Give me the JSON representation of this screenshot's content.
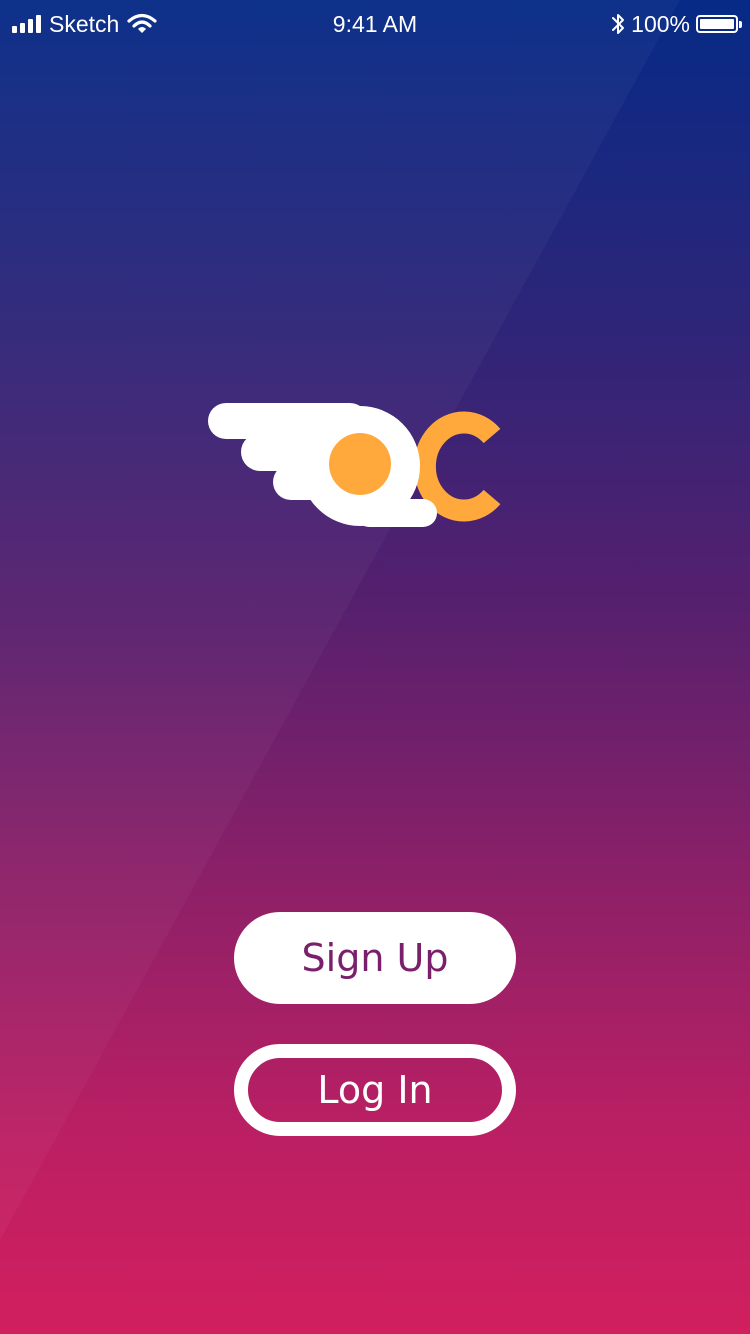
{
  "status_bar": {
    "carrier": "Sketch",
    "time": "9:41 AM",
    "battery": "100%",
    "icons": [
      "signal-bars-icon",
      "wifi-icon",
      "bluetooth-icon",
      "battery-icon"
    ]
  },
  "logo": {
    "icon": "winged-egg-logo",
    "colors": {
      "wing": "#ffffff",
      "yolk": "#ffa93d",
      "letter": "#ffa93d"
    }
  },
  "actions": {
    "signup_label": "Sign Up",
    "login_label": "Log In"
  },
  "colors": {
    "gradient_top": "#062a86",
    "gradient_bottom": "#d21f5e",
    "accent": "#ffa93d",
    "signup_text": "#7a1f6c"
  }
}
